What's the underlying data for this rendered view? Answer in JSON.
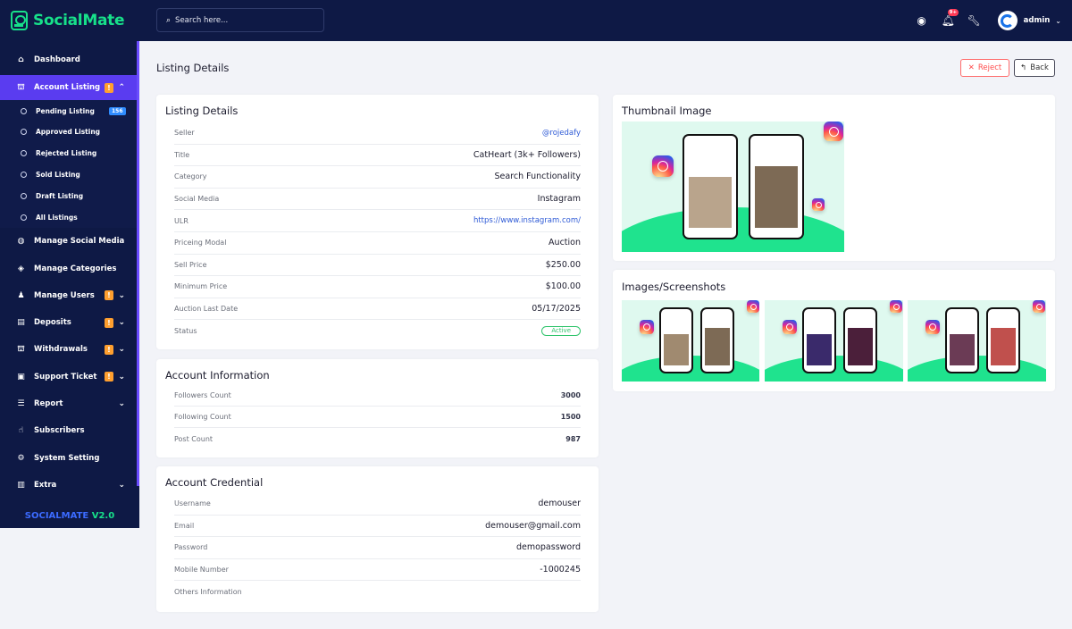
{
  "app": {
    "brand": "SocialMate",
    "version_prefix": "SOCIALMATE",
    "version": "V2.0"
  },
  "search": {
    "placeholder": "Search here..."
  },
  "topbar": {
    "user": "admin",
    "notification_badge": "9+"
  },
  "sidebar": {
    "items": [
      {
        "label": "Dashboard",
        "icon": "home-icon"
      },
      {
        "label": "Account Listing",
        "icon": "bank-icon",
        "warn": "!",
        "expanded": true
      },
      {
        "label": "Manage Social Media",
        "icon": "globe-icon"
      },
      {
        "label": "Manage Categories",
        "icon": "layers-icon"
      },
      {
        "label": "Manage Users",
        "icon": "users-icon",
        "warn": "!"
      },
      {
        "label": "Deposits",
        "icon": "file-icon",
        "warn": "!"
      },
      {
        "label": "Withdrawals",
        "icon": "bank-icon",
        "warn": "!"
      },
      {
        "label": "Support Ticket",
        "icon": "ticket-icon",
        "warn": "!"
      },
      {
        "label": "Report",
        "icon": "list-icon"
      },
      {
        "label": "Subscribers",
        "icon": "thumbs-up-icon"
      },
      {
        "label": "System Setting",
        "icon": "gear-icon"
      },
      {
        "label": "Extra",
        "icon": "server-icon"
      }
    ],
    "submenu": [
      {
        "label": "Pending Listing",
        "badge": "156"
      },
      {
        "label": "Approved Listing"
      },
      {
        "label": "Rejected Listing"
      },
      {
        "label": "Sold Listing"
      },
      {
        "label": "Draft Listing"
      },
      {
        "label": "All Listings"
      }
    ]
  },
  "page": {
    "title": "Listing Details",
    "reject_label": "Reject",
    "back_label": "Back"
  },
  "listing": {
    "title": "Listing Details",
    "rows": [
      {
        "label": "Seller",
        "value": "@rojedafy"
      },
      {
        "label": "Title",
        "value": "CatHeart (3k+ Followers)"
      },
      {
        "label": "Category",
        "value": "Search Functionality"
      },
      {
        "label": "Social Media",
        "value": "Instagram"
      },
      {
        "label": "ULR",
        "value": "https://www.instagram.com/"
      },
      {
        "label": "Priceing Modal",
        "value": "Auction"
      },
      {
        "label": "Sell Price",
        "value": "$250.00"
      },
      {
        "label": "Minimum Price",
        "value": "$100.00"
      },
      {
        "label": "Auction Last Date",
        "value": "05/17/2025"
      },
      {
        "label": "Status",
        "value": "Active"
      }
    ]
  },
  "account_info": {
    "title": "Account Information",
    "rows": [
      {
        "label": "Followers Count",
        "value": "3000"
      },
      {
        "label": "Following Count",
        "value": "1500"
      },
      {
        "label": "Post Count",
        "value": "987"
      }
    ]
  },
  "credential": {
    "title": "Account Credential",
    "rows": [
      {
        "label": "Username",
        "value": "demouser"
      },
      {
        "label": "Email",
        "value": "demouser@gmail.com"
      },
      {
        "label": "Password",
        "value": "demopassword"
      },
      {
        "label": "Mobile Number",
        "value": "-1000245"
      },
      {
        "label": "Others Information",
        "value": ""
      }
    ]
  },
  "thumbnail": {
    "title": "Thumbnail Image"
  },
  "screenshots": {
    "title": "Images/Screenshots"
  }
}
